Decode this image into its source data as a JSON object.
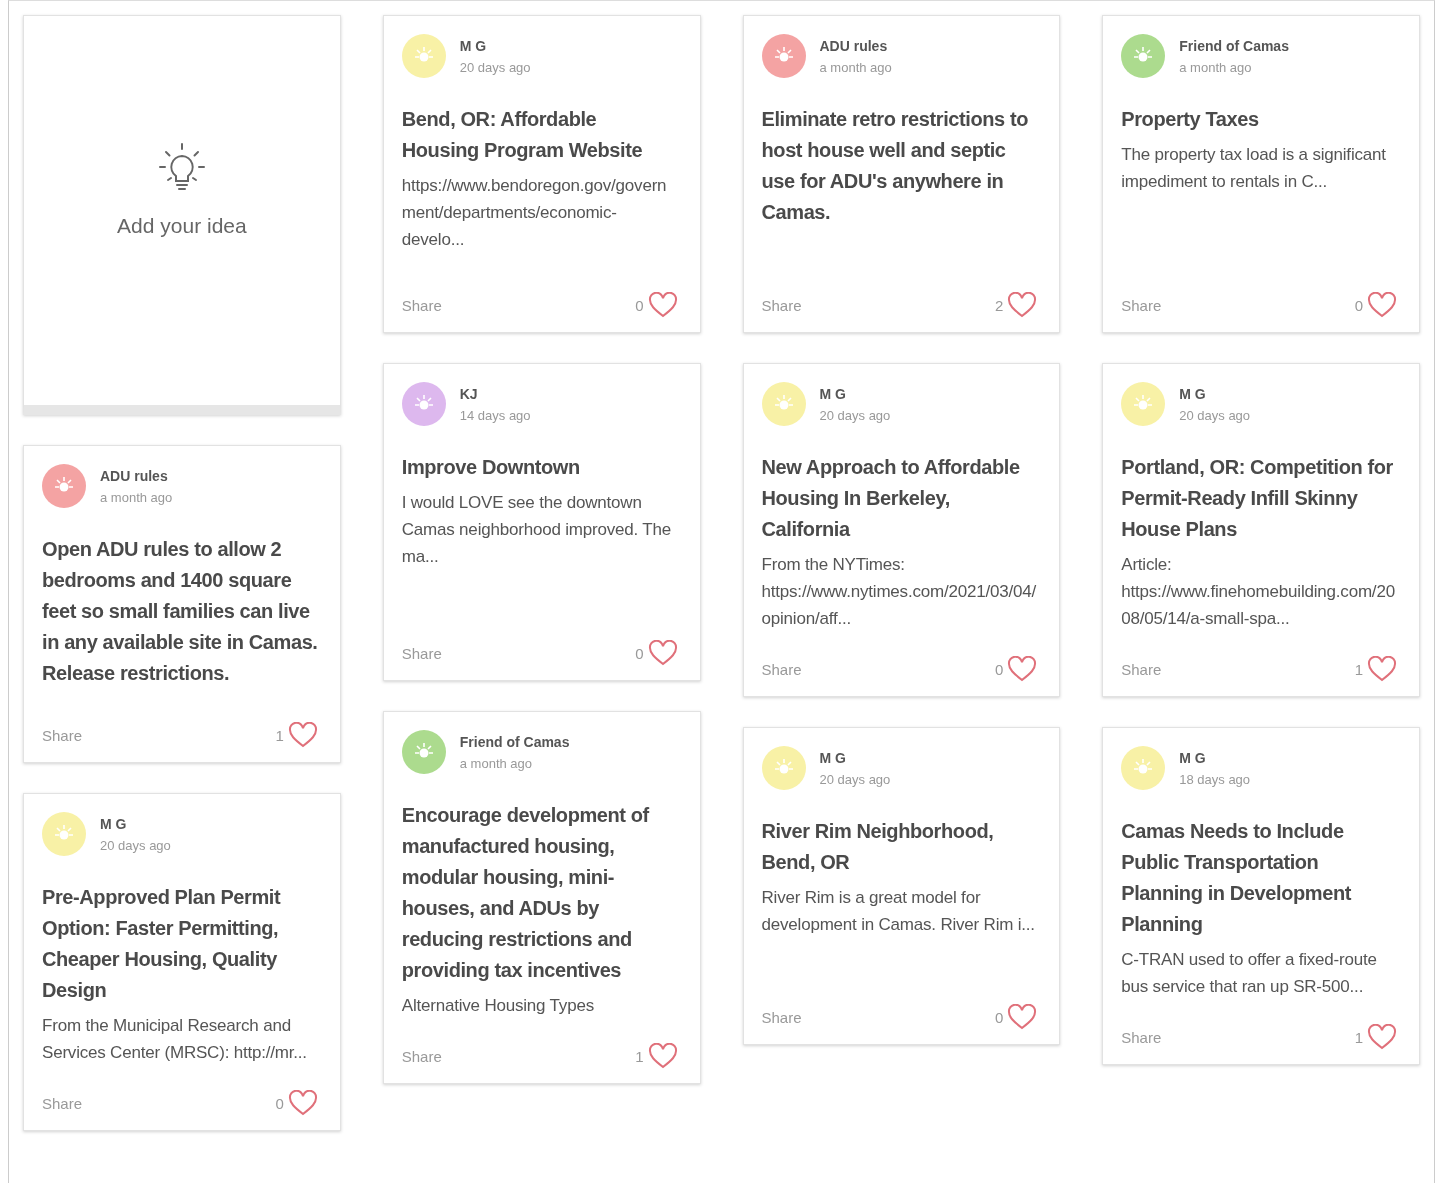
{
  "columns": [
    {
      "cards": [
        {
          "kind": "add",
          "label": "Add your idea"
        },
        {
          "kind": "idea",
          "author": "ADU rules",
          "time": "a month ago",
          "color": "#f4a3a3",
          "title": "Open ADU rules to allow 2 bedrooms and 1400 square feet so small families can live in any available site in Camas. Release restrictions.",
          "share": "Share",
          "likes": "1"
        },
        {
          "kind": "idea",
          "author": "M G",
          "time": "20 days ago",
          "color": "#f8f1a6",
          "title": "Pre-Approved Plan Permit Option: Faster Permitting, Cheaper Housing, Quality Design",
          "body": "From the Municipal Research and Services Center (MRSC): http://mr...",
          "share": "Share",
          "likes": "0"
        }
      ]
    },
    {
      "cards": [
        {
          "kind": "idea",
          "author": "M G",
          "time": "20 days ago",
          "color": "#f8f1a6",
          "title": "Bend, OR: Affordable Housing Program Website",
          "body": "https://www.bendoregon.gov/government/departments/economic-develo...",
          "share": "Share",
          "likes": "0"
        },
        {
          "kind": "idea",
          "author": "KJ",
          "time": "14 days ago",
          "color": "#ddb8ee",
          "title": "Improve Downtown",
          "body": "I would LOVE see the downtown Camas neighborhood improved. The ma...",
          "share": "Share",
          "likes": "0"
        },
        {
          "kind": "idea",
          "author": "Friend of Camas",
          "time": "a month ago",
          "color": "#acdb8e",
          "title": "Encourage development of manufactured housing, modular housing, mini-houses, and ADUs by reducing restrictions and providing tax incentives",
          "body": "Alternative Housing Types",
          "share": "Share",
          "likes": "1"
        }
      ]
    },
    {
      "cards": [
        {
          "kind": "idea",
          "author": "ADU rules",
          "time": "a month ago",
          "color": "#f4a3a3",
          "title": "Eliminate retro restrictions to host house well and septic use for ADU's anywhere in Camas.",
          "share": "Share",
          "likes": "2"
        },
        {
          "kind": "idea",
          "author": "M G",
          "time": "20 days ago",
          "color": "#f8f1a6",
          "title": "New Approach to Affordable Housing In Berkeley, California",
          "body": "From the NYTimes: https://www.nytimes.com/2021/03/04/opinion/aff...",
          "share": "Share",
          "likes": "0"
        },
        {
          "kind": "idea",
          "author": "M G",
          "time": "20 days ago",
          "color": "#f8f1a6",
          "title": "River Rim Neighborhood, Bend, OR",
          "body": "River Rim is a great model for development in Camas.  River Rim i...",
          "share": "Share",
          "likes": "0"
        }
      ]
    },
    {
      "cards": [
        {
          "kind": "idea",
          "author": "Friend of Camas",
          "time": "a month ago",
          "color": "#acdb8e",
          "title": "Property Taxes",
          "body": "The property tax load is a significant impediment to rentals in C...",
          "share": "Share",
          "likes": "0"
        },
        {
          "kind": "idea",
          "author": "M G",
          "time": "20 days ago",
          "color": "#f8f1a6",
          "title": "Portland, OR: Competition for Permit-Ready Infill Skinny House Plans",
          "body": "Article: https://www.finehomebuilding.com/2008/05/14/a-small-spa...",
          "share": "Share",
          "likes": "1"
        },
        {
          "kind": "idea",
          "author": "M G",
          "time": "18 days ago",
          "color": "#f8f1a6",
          "title": "Camas Needs to Include Public Transportation Planning in Development Planning",
          "body": "C-TRAN used to offer a fixed-route bus service that ran up SR-500...",
          "share": "Share",
          "likes": "1"
        }
      ]
    }
  ]
}
